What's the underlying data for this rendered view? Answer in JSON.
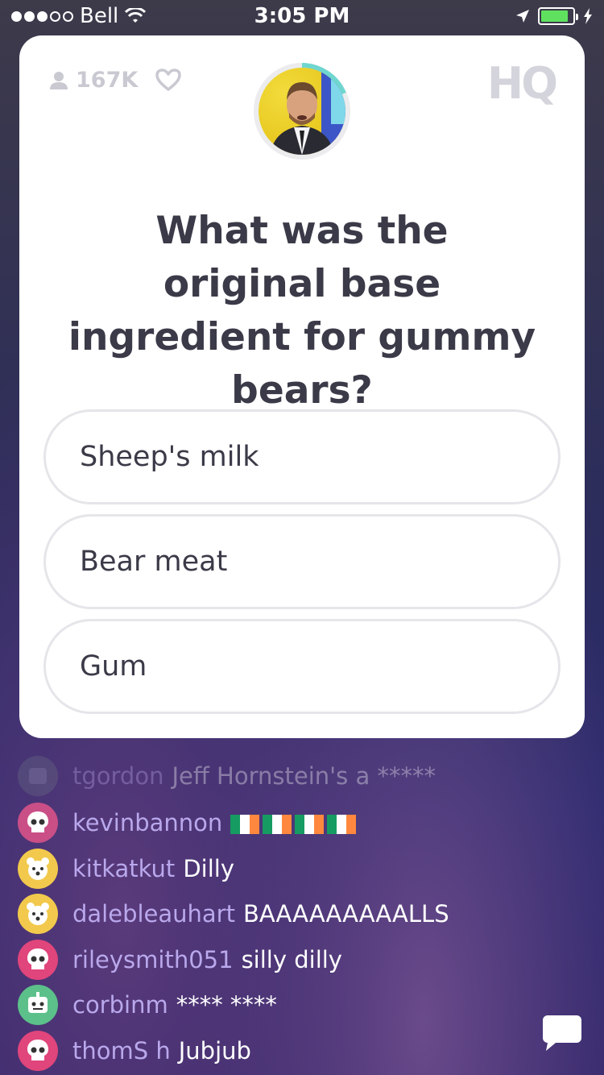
{
  "status_bar": {
    "carrier": "Bell",
    "time": "3:05 PM"
  },
  "card": {
    "viewers": "167K",
    "logo": "HQ",
    "question": "What was the original base ingredient for gummy bears?",
    "answers": [
      {
        "label": "Sheep's milk"
      },
      {
        "label": "Bear meat"
      },
      {
        "label": "Gum"
      }
    ]
  },
  "chat": [
    {
      "user": "tgordon",
      "message": "Jeff Hornstein's a *****",
      "avatar_color": "#6b6f86",
      "faded": true
    },
    {
      "user": "kevinbannon",
      "message": "",
      "flags": 4,
      "avatar_color": "#c94f86"
    },
    {
      "user": "kitkatkut",
      "message": "Dilly",
      "avatar_color": "#f2c94c"
    },
    {
      "user": "dalebleauhart",
      "message": "BAAAAAAAAALLS",
      "avatar_color": "#f2c94c"
    },
    {
      "user": "rileysmith051",
      "message": "silly dilly",
      "avatar_color": "#e0457b"
    },
    {
      "user": "corbinm",
      "message": "**** ****",
      "avatar_color": "#5cc08a"
    },
    {
      "user": "thomS h",
      "message": "Jubjub",
      "avatar_color": "#e0457b"
    }
  ],
  "colors": {
    "flag_green": "#169b62",
    "flag_white": "#ffffff",
    "flag_orange": "#ff883e"
  }
}
